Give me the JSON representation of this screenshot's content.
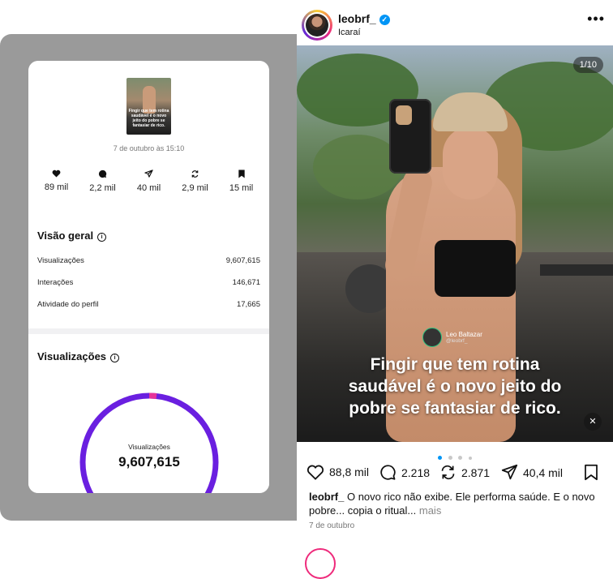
{
  "insights": {
    "thumbnail_text": "Fingir que tem rotina saudável é o novo jeito do pobre se fantasiar de rico.",
    "post_date": "7 de outubro às 15:10",
    "metrics": [
      {
        "icon": "heart-icon",
        "value": "89 mil"
      },
      {
        "icon": "comment-icon",
        "value": "2,2 mil"
      },
      {
        "icon": "share-icon",
        "value": "40 mil"
      },
      {
        "icon": "repost-icon",
        "value": "2,9 mil"
      },
      {
        "icon": "bookmark-icon",
        "value": "15 mil"
      }
    ],
    "overview": {
      "title": "Visão geral",
      "rows": [
        {
          "label": "Visualizações",
          "value": "9,607,615"
        },
        {
          "label": "Interações",
          "value": "146,671"
        },
        {
          "label": "Atividade do perfil",
          "value": "17,665"
        }
      ]
    },
    "views": {
      "title": "Visualizações",
      "ring_label": "Visualizações",
      "ring_value": "9,607,615",
      "colors": {
        "primary": "#6a1fe0",
        "accent": "#e6339a"
      }
    }
  },
  "post": {
    "username": "leobrf_",
    "location": "Icaraí",
    "counter": "1/10",
    "credit_name": "Leo Baltazar",
    "credit_handle": "@leobrf_",
    "overlay_lines": [
      "Fingir que tem rotina",
      "saudável é o novo jeito do",
      "pobre se fantasiar de rico."
    ],
    "likes": "88,8 mil",
    "comments": "2.218",
    "reposts": "2.871",
    "shares": "40,4 mil",
    "caption_user": "leobrf_",
    "caption_text": "O novo rico não exibe. Ele performa saúde. E o novo pobre... copia o ritual...",
    "caption_more": "mais",
    "date": "7 de outubro",
    "colors": {
      "verified": "#0095f6",
      "active_dot": "#0095f6"
    }
  }
}
